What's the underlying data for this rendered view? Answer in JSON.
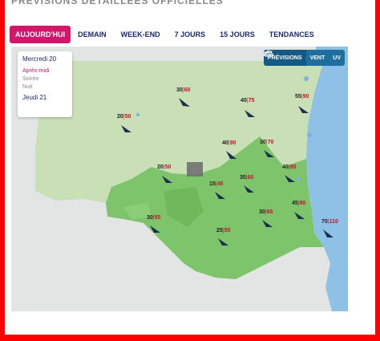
{
  "page": {
    "title_partial": "PREVISIONS DETAILLEES OFFICIELLES"
  },
  "tabs": [
    {
      "label": "AUJOURD'HUI",
      "active": true
    },
    {
      "label": "DEMAIN",
      "active": false
    },
    {
      "label": "WEEK-END",
      "active": false
    },
    {
      "label": "7 JOURS",
      "active": false
    },
    {
      "label": "15 JOURS",
      "active": false
    },
    {
      "label": "TENDANCES",
      "active": false
    }
  ],
  "day_panel": {
    "day1": "Mercredi 20",
    "periods": [
      {
        "label": "Après-midi",
        "active": true
      },
      {
        "label": "Soirée",
        "active": false
      },
      {
        "label": "Nuit",
        "active": false
      }
    ],
    "day2": "Jeudi 21"
  },
  "modes": [
    {
      "label": "PRÉVISIONS",
      "icon": "cloud-sun-icon",
      "active": true
    },
    {
      "label": "VENT",
      "icon": "wind-icon",
      "active": false
    },
    {
      "label": "UV",
      "icon": "uv-sun-icon",
      "active": false
    }
  ],
  "colors": {
    "accent": "#d3156b",
    "nav": "#1d2a6b",
    "mode_bar": "#1f6f9e",
    "gust": "#c8102e",
    "sea": "#8fc1e6"
  },
  "wind": [
    {
      "id": "w1",
      "speed": "30",
      "gust": "60",
      "direction": "NW"
    },
    {
      "id": "w2",
      "speed": "20",
      "gust": "50",
      "direction": "NW"
    },
    {
      "id": "w3",
      "speed": "40",
      "gust": "75",
      "direction": "NW"
    },
    {
      "id": "w4",
      "speed": "55",
      "gust": "90",
      "direction": "NW"
    },
    {
      "id": "w5",
      "speed": "40",
      "gust": "90",
      "direction": "NW"
    },
    {
      "id": "w6",
      "speed": "30",
      "gust": "70",
      "direction": "NW"
    },
    {
      "id": "w7",
      "speed": "20",
      "gust": "50",
      "direction": "NW"
    },
    {
      "id": "w8",
      "speed": "35",
      "gust": "60",
      "direction": "NW"
    },
    {
      "id": "w9",
      "speed": "40",
      "gust": "85",
      "direction": "NW"
    },
    {
      "id": "w10",
      "speed": "15",
      "gust": "45",
      "direction": "NW"
    },
    {
      "id": "w11",
      "speed": "30",
      "gust": "55",
      "direction": "NW"
    },
    {
      "id": "w12",
      "speed": "30",
      "gust": "65",
      "direction": "NW"
    },
    {
      "id": "w13",
      "speed": "45",
      "gust": "80",
      "direction": "NW"
    },
    {
      "id": "w14",
      "speed": "25",
      "gust": "55",
      "direction": "NW"
    },
    {
      "id": "w15",
      "speed": "70",
      "gust": "110",
      "direction": "NW"
    }
  ]
}
